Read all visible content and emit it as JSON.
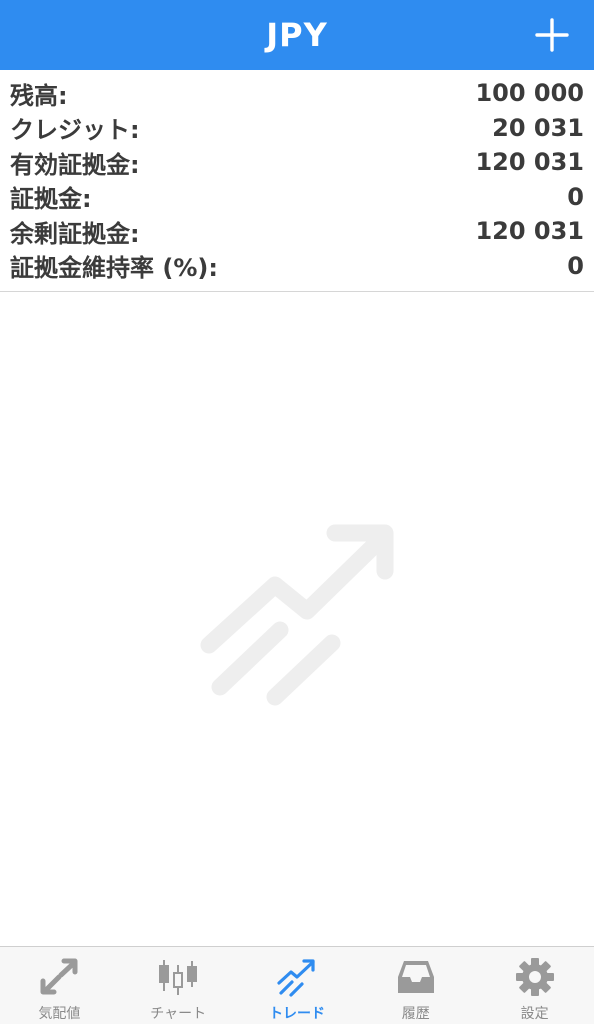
{
  "header": {
    "title": "JPY",
    "add_icon": "plus-icon"
  },
  "summary": {
    "rows": [
      {
        "label": "残高:",
        "value": "100 000"
      },
      {
        "label": "クレジット:",
        "value": "20 031"
      },
      {
        "label": "有効証拠金:",
        "value": "120 031"
      },
      {
        "label": "証拠金:",
        "value": "0"
      },
      {
        "label": "余剰証拠金:",
        "value": "120 031"
      },
      {
        "label": "証拠金維持率 (%):",
        "value": "0"
      }
    ]
  },
  "empty_state": {
    "icon": "trade-trend-icon"
  },
  "tabbar": {
    "tabs": [
      {
        "label": "気配値",
        "icon": "quotes-arrows-icon",
        "active": false
      },
      {
        "label": "チャート",
        "icon": "candlestick-icon",
        "active": false
      },
      {
        "label": "トレード",
        "icon": "trade-trend-icon",
        "active": true
      },
      {
        "label": "履歴",
        "icon": "inbox-tray-icon",
        "active": false
      },
      {
        "label": "設定",
        "icon": "gear-icon",
        "active": false
      }
    ]
  },
  "colors": {
    "accent": "#2f8cf0",
    "text": "#3b3b3b",
    "inactive": "#8a8a8a",
    "illustration": "#eeeeee"
  }
}
